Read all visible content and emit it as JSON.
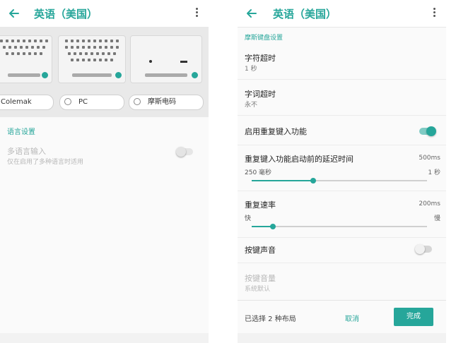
{
  "left": {
    "title": "英语（美国）",
    "layout_options": [
      {
        "label": "Colemak"
      },
      {
        "label": "PC"
      },
      {
        "label": "摩斯电码"
      }
    ],
    "section_label": "语言设置",
    "multilang": {
      "title": "多语言输入",
      "subtitle": "仅在启用了多种语言时适用",
      "enabled": false
    }
  },
  "right": {
    "title": "英语（美国）",
    "section_label": "摩斯键盘设置",
    "char_timeout": {
      "title": "字符超时",
      "value": "1 秒"
    },
    "word_timeout": {
      "title": "字词超时",
      "value": "永不"
    },
    "repeat_enable": {
      "title": "启用重复键入功能",
      "enabled": true
    },
    "repeat_delay": {
      "title": "重复键入功能启动前的延迟时间",
      "value": "500ms",
      "min_label": "250 毫秒",
      "max_label": "1 秒",
      "fraction": 0.35
    },
    "repeat_rate": {
      "title": "重复速率",
      "value": "200ms",
      "min_label": "快",
      "max_label": "慢",
      "fraction": 0.12
    },
    "key_sound": {
      "title": "按键声音",
      "enabled": false
    },
    "key_volume": {
      "title": "按键音量",
      "value": "系统默认"
    },
    "footer": {
      "selected": "已选择 2 种布局",
      "cancel": "取消",
      "done": "完成"
    }
  },
  "colors": {
    "accent": "#26a69a",
    "accent_light": "#80cbc4"
  }
}
